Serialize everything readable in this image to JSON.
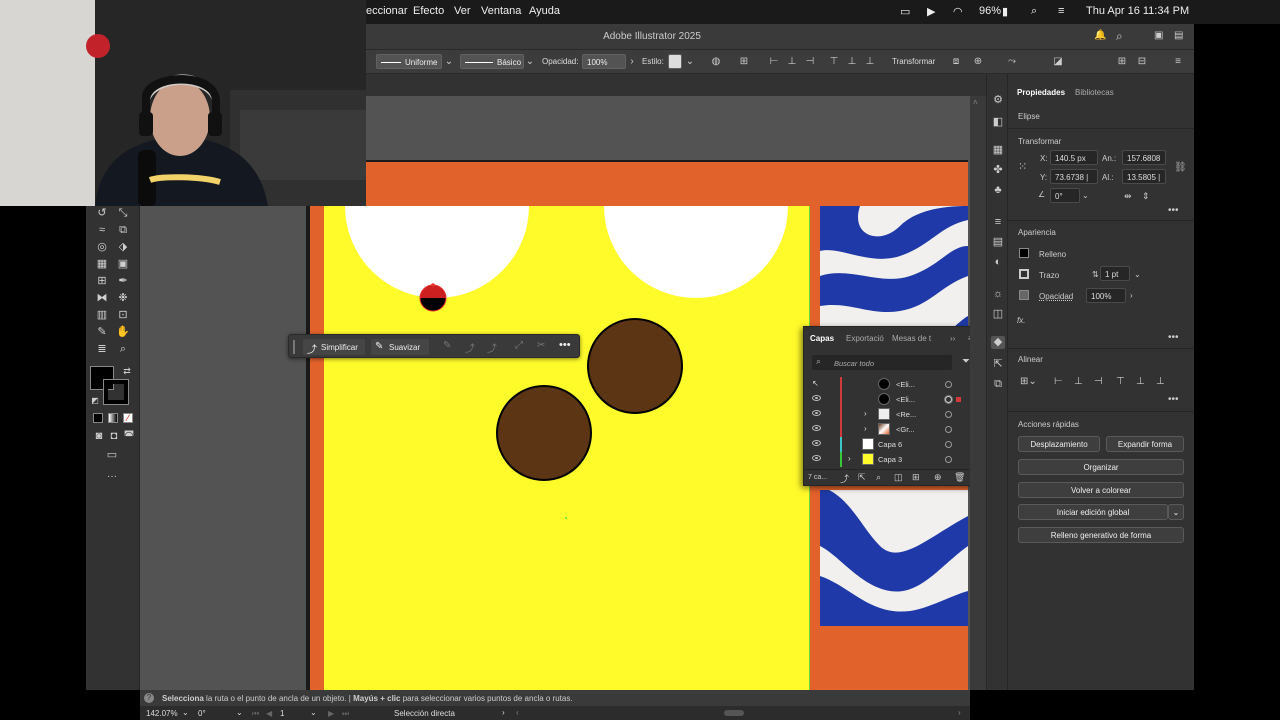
{
  "menubar": {
    "items": [
      "eccionar",
      "Efecto",
      "Ver",
      "Ventana",
      "Ayuda"
    ],
    "battery": "96%",
    "datetime": "Thu Apr 16  11:34 PM"
  },
  "window": {
    "title": "Adobe Illustrator 2025"
  },
  "controlbar": {
    "stroke_profile": "Uniforme",
    "brush": "Básico",
    "opacity_label": "Opacidad:",
    "opacity_value": "100%",
    "style_label": "Estilo:",
    "transform_label": "Transformar"
  },
  "simplify_bar": {
    "simplify": "Simplificar",
    "smooth": "Suavizar"
  },
  "layers_panel": {
    "tabs": [
      "Capas",
      "Exportació",
      "Mesas de t"
    ],
    "search_placeholder": "Buscar todo",
    "rows": [
      {
        "name": "<Eli...",
        "bar": "#d23a3a",
        "thumb": "#000000",
        "expand": ""
      },
      {
        "name": "<Eli...",
        "bar": "#d23a3a",
        "thumb": "#000000",
        "expand": ""
      },
      {
        "name": "<Re...",
        "bar": "#d23a3a",
        "thumb": "#eeeeee",
        "expand": "›"
      },
      {
        "name": "<Gr...",
        "bar": "#d23a3a",
        "thumb": "#6a3b1a",
        "expand": "›"
      },
      {
        "name": "Capa 6",
        "bar": "#39c6c6",
        "thumb": "#ffffff",
        "expand": ""
      },
      {
        "name": "Capa 3",
        "bar": "#39c639",
        "thumb": "#fffb2a",
        "expand": "›"
      }
    ],
    "layer_count": "7 ca..."
  },
  "properties": {
    "tabs": [
      "Propiedades",
      "Bibliotecas"
    ],
    "object": "Elipse",
    "transform_title": "Transformar",
    "x_label": "X:",
    "x_value": "140.5 px",
    "y_label": "Y:",
    "y_value": "73.6738 |",
    "w_label": "An.:",
    "w_value": "157.6808",
    "h_label": "Al.:",
    "h_value": "13.5805 |",
    "angle_value": "0°",
    "appearance_title": "Apariencia",
    "fill_label": "Relleno",
    "stroke_label": "Trazo",
    "stroke_value": "1 pt",
    "opacity_label": "Opacidad",
    "opacity_value": "100%",
    "fx": "fx.",
    "align_title": "Alinear",
    "quick_actions_title": "Acciones rápidas",
    "buttons": {
      "offset": "Desplazamiento",
      "expand": "Expandir forma",
      "arrange": "Organizar",
      "recolor": "Volver a colorear",
      "global_edit": "Iniciar edición global",
      "generative_fill": "Relleno generativo de forma"
    }
  },
  "statusbar": {
    "hint_strong1": "Selecciona",
    "hint1": " la ruta o el punto de ancla de un objeto.  |  ",
    "hint_strong2": "Mayús + clic",
    "hint2": " para seleccionar varios puntos de ancla o rutas.",
    "zoom": "142.07%",
    "rotation": "0°",
    "artboard": "1",
    "tool": "Selección directa"
  },
  "colors": {
    "yellow": "#fffb2a",
    "orange": "#e2622b",
    "brown": "#5c3514",
    "zebra_blue": "#1f3aa8"
  }
}
